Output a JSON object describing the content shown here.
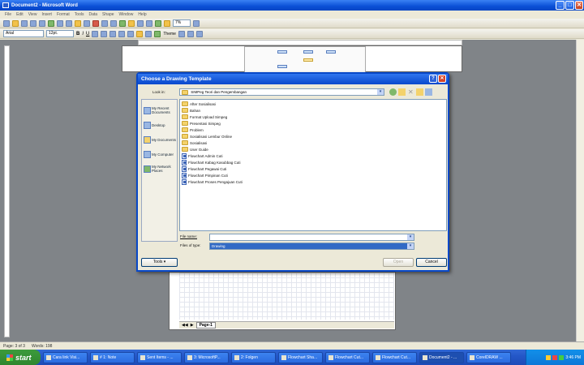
{
  "window": {
    "title": "Document2 - Microsoft Word"
  },
  "menu": [
    "File",
    "Edit",
    "View",
    "Insert",
    "Format",
    "Tools",
    "Data",
    "Shape",
    "Window",
    "Help"
  ],
  "format_bar": {
    "font": "Arial",
    "size": "12pt.",
    "theme_label": "Theme",
    "zoom": "7%"
  },
  "dialog": {
    "title": "Choose a Drawing Template",
    "look_in_label": "Look in:",
    "look_in_value": "SIMPeg Teori dan Pengembangan",
    "places": [
      {
        "label": "My Recent Documents",
        "icon": "recent-documents-icon"
      },
      {
        "label": "Desktop",
        "icon": "desktop-icon"
      },
      {
        "label": "My Documents",
        "icon": "my-documents-icon"
      },
      {
        "label": "My Computer",
        "icon": "my-computer-icon"
      },
      {
        "label": "My Network Places",
        "icon": "network-places-icon"
      }
    ],
    "files": [
      {
        "name": "After Sosialisasi",
        "type": "folder"
      },
      {
        "name": "Bahan",
        "type": "folder"
      },
      {
        "name": "Format Upload Simpeg",
        "type": "folder"
      },
      {
        "name": "Presentasi Simpeg",
        "type": "folder"
      },
      {
        "name": "Problem",
        "type": "folder"
      },
      {
        "name": "Sosialisasi Lembur Online",
        "type": "folder"
      },
      {
        "name": "Sosialisasi",
        "type": "folder"
      },
      {
        "name": "User Guide",
        "type": "folder"
      },
      {
        "name": "Flowchart Admin Cuti",
        "type": "visio"
      },
      {
        "name": "Flowchart Kabag Kasubbag Cuti",
        "type": "visio"
      },
      {
        "name": "Flowchart Pegawai Cuti",
        "type": "visio"
      },
      {
        "name": "Flowchart Pimpinan Cuti",
        "type": "visio"
      },
      {
        "name": "Flowchart Proses Pengajuan Cuti",
        "type": "visio"
      }
    ],
    "file_name_label": "File name:",
    "file_name_value": "",
    "files_of_type_label": "Files of type:",
    "files_of_type_value": "Drawing",
    "tools_label": "Tools",
    "open_label": "Open",
    "cancel_label": "Cancel"
  },
  "document": {
    "page_tab": "Page-1"
  },
  "status": {
    "page": "Page: 3 of 3",
    "words": "Words: 198"
  },
  "taskbar": {
    "start": "start",
    "tasks": [
      "Cara link Visi...",
      "# 1: Note",
      "Sent Items - ...",
      "3: MicrosoftP...",
      "2: Folgen",
      "Flowchart Sha...",
      "Flowchart Cut...",
      "Flowchart Cut...",
      "Document2 - ...",
      "CorelDRAW ..."
    ],
    "clock": "3:46 PM"
  }
}
